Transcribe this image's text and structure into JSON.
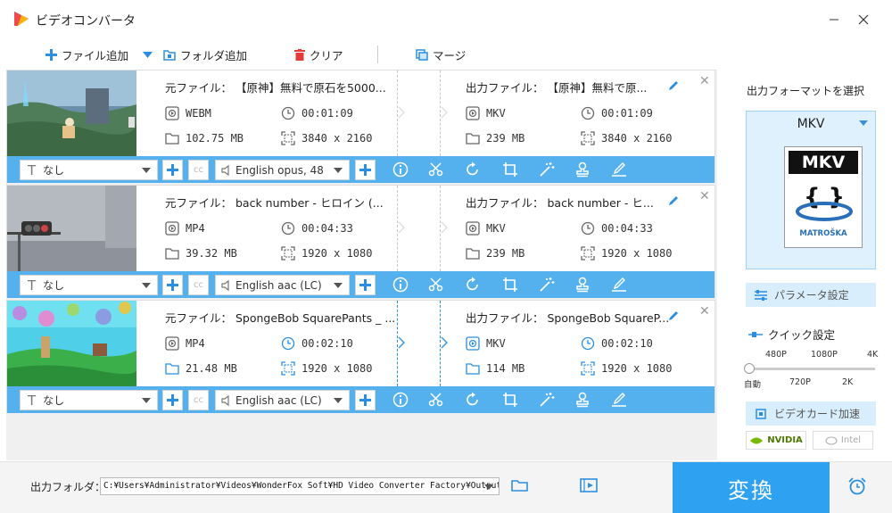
{
  "window": {
    "title": "ビデオコンバータ"
  },
  "toolbar": {
    "add_file": "ファイル追加",
    "add_folder": "フォルダ追加",
    "clear": "クリア",
    "merge": "マージ"
  },
  "files": [
    {
      "source_name": "元ファイル： 【原神】無料で原石を5000...",
      "source_format": "WEBM",
      "source_duration": "00:01:09",
      "source_size": "102.75 MB",
      "source_resolution": "3840 x 2160",
      "output_name": "出力ファイル： 【原神】無料で原...",
      "output_format": "MKV",
      "output_duration": "00:01:09",
      "output_size": "239 MB",
      "output_resolution": "3840 x 2160",
      "subtitle": "なし",
      "audio": "English opus, 48"
    },
    {
      "source_name": "元ファイル： back number - ヒロイン (...",
      "source_format": "MP4",
      "source_duration": "00:04:33",
      "source_size": "39.32 MB",
      "source_resolution": "1920 x 1080",
      "output_name": "出力ファイル： back number - ヒ...",
      "output_format": "MKV",
      "output_duration": "00:04:33",
      "output_size": "239 MB",
      "output_resolution": "1920 x 1080",
      "subtitle": "なし",
      "audio": "English aac (LC)"
    },
    {
      "source_name": "元ファイル： SpongeBob SquarePants _ ...",
      "source_format": "MP4",
      "source_duration": "00:02:10",
      "source_size": "21.48 MB",
      "source_resolution": "1920 x 1080",
      "output_name": "出力ファイル： SpongeBob SquareP...",
      "output_format": "MKV",
      "output_duration": "00:02:10",
      "output_size": "114 MB",
      "output_resolution": "1920 x 1080",
      "subtitle": "なし",
      "audio": "English aac (LC)"
    }
  ],
  "right_panel": {
    "format_title": "出力フォーマットを選択",
    "selected_format": "MKV",
    "logo_text_top": "MKV",
    "logo_text_bottom": "MATROŠKA",
    "param_settings": "パラメータ設定",
    "quick_settings": "クイック設定",
    "quality_labels_top": [
      "480P",
      "1080P",
      "4K"
    ],
    "quality_labels_bottom": [
      "自動",
      "720P",
      "2K"
    ],
    "gpu_accel": "ビデオカード加速",
    "nvidia": "NVIDIA",
    "intel": "Intel"
  },
  "bottom": {
    "output_folder_label": "出力フォルダ：",
    "output_path": "C:¥Users¥Administrator¥Videos¥WonderFox Soft¥HD Video Converter Factory¥OutputVideo¥",
    "convert": "変換"
  },
  "colors": {
    "accent": "#2ea1f0",
    "bar": "#54b1ee",
    "icon_blue": "#2a8fe0",
    "clear_red": "#e23b3b"
  }
}
